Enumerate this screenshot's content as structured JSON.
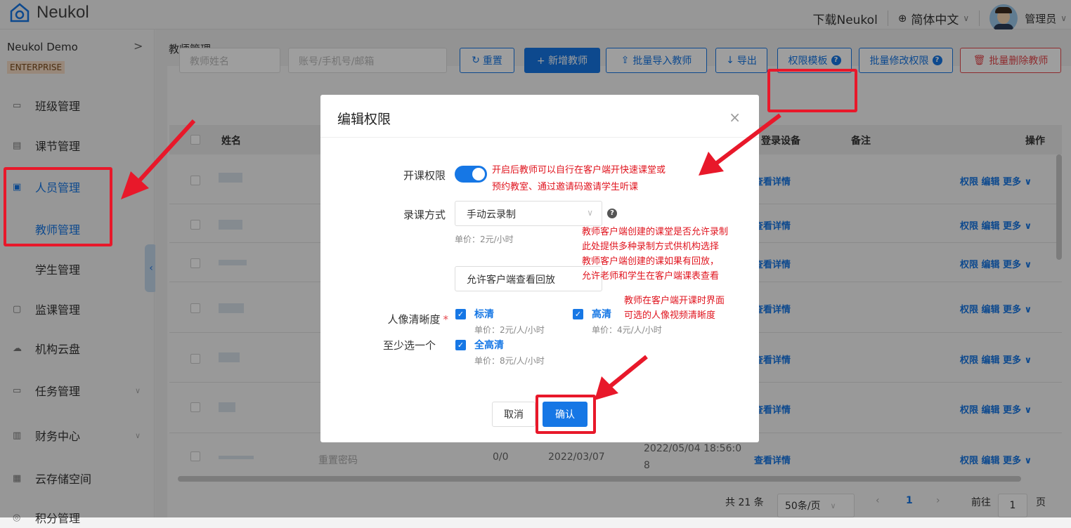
{
  "app": {
    "name": "Neukol",
    "download": "下载Neukol",
    "language": "简体中文",
    "user": "管理员"
  },
  "sidebar": {
    "org_name": "Neukol Demo",
    "org_badge": "ENTERPRISE",
    "items": [
      {
        "label": "班级管理",
        "icon": "class-icon"
      },
      {
        "label": "课节管理",
        "icon": "lesson-icon"
      },
      {
        "label": "人员管理",
        "icon": "people-icon"
      },
      {
        "label": "教师管理"
      },
      {
        "label": "学生管理"
      },
      {
        "label": "监课管理",
        "icon": "monitor-icon"
      },
      {
        "label": "机构云盘",
        "icon": "cloud-icon"
      },
      {
        "label": "任务管理",
        "icon": "task-icon"
      },
      {
        "label": "财务中心",
        "icon": "finance-icon"
      },
      {
        "label": "云存储空间",
        "icon": "storage-icon"
      },
      {
        "label": "积分管理",
        "icon": "points-icon"
      }
    ]
  },
  "breadcrumb": "教师管理",
  "filters": {
    "name_placeholder": "教师姓名",
    "account_placeholder": "账号/手机号/邮箱"
  },
  "toolbar": {
    "reset": "重置",
    "add": "+ 新增教师",
    "import": "批量导入教师",
    "export": "导出",
    "template": "权限模板",
    "batch_edit": "批量修改权限",
    "batch_delete": "批量删除教师"
  },
  "table": {
    "headers": {
      "name": "姓名",
      "device": "登录设备",
      "remark": "备注",
      "ops": "操作"
    },
    "detail_link": "查看详情",
    "actions": "权限  编辑  更多 ∨",
    "last_row": {
      "password": "重置密码",
      "count": "0/0",
      "date": "2022/03/07",
      "time_line1": "2022/05/04 18:56:0",
      "time_line2": "8"
    }
  },
  "pagination": {
    "total": "共 21 条",
    "per_page": "50条/页",
    "current": "1",
    "goto_label": "前往",
    "goto_value": "1",
    "page_unit": "页"
  },
  "modal": {
    "title": "编辑权限",
    "open_class_label": "开课权限",
    "record_label": "录课方式",
    "record_value": "手动云录制",
    "record_price": "单价：2元/小时",
    "replay_label": "允许客户端查看回放",
    "quality_label": "人像清晰度",
    "quality_sub": "至少选一个",
    "sd_label": "标清",
    "sd_price": "单价：2元/人/小时",
    "hd_label": "高清",
    "hd_price": "单价：4元/人/小时",
    "fhd_label": "全高清",
    "fhd_price": "单价：8元/人/小时",
    "cancel": "取消",
    "confirm": "确认"
  },
  "annotations": {
    "toggle_note_1": "开启后教师可以自行在客户端开快速课堂或",
    "toggle_note_2": "预约教室、通过邀请码邀请学生听课",
    "record_note_1": "教师客户端创建的课堂是否允许录制",
    "record_note_2": "此处提供多种录制方式供机构选择",
    "record_note_3": "教师客户端创建的课如果有回放，",
    "record_note_4": "允许老师和学生在客户端课表查看",
    "quality_note_1": "教师在客户端开课时界面",
    "quality_note_2": "可选的人像视频清晰度"
  },
  "colors": {
    "accent": "#1677e5",
    "danger": "#e5484d",
    "annotation": "#e8182a"
  }
}
